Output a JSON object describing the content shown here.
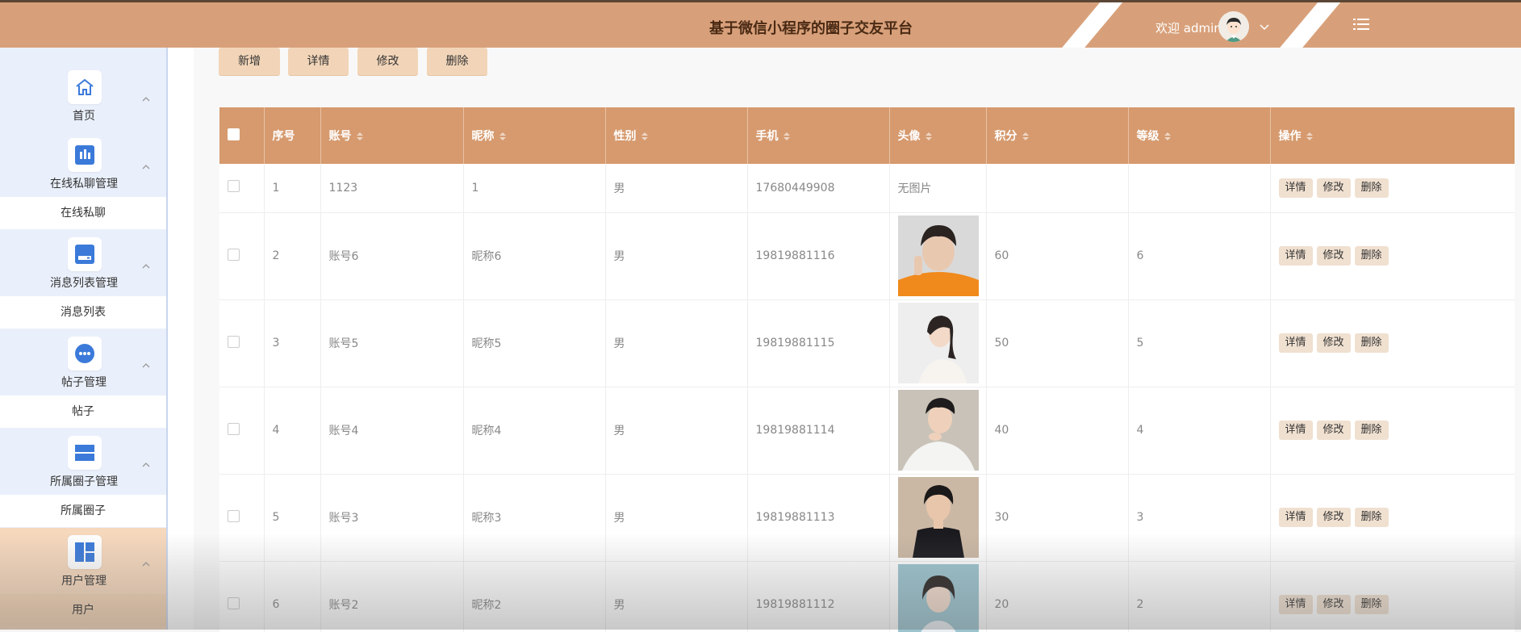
{
  "header": {
    "title": "基于微信小程序的圈子交友平台",
    "welcome": "欢迎 admin",
    "avatar_icon": "user-avatar-icon",
    "menu_icon": "menu-icon"
  },
  "sidebar": {
    "groups": [
      {
        "label": "首页",
        "icon": "home-icon"
      },
      {
        "label": "在线私聊管理",
        "icon": "chart-bars-icon",
        "sub": "在线私聊"
      },
      {
        "label": "消息列表管理",
        "icon": "drive-icon",
        "sub": "消息列表"
      },
      {
        "label": "帖子管理",
        "icon": "dots-circle-icon",
        "sub": "帖子"
      },
      {
        "label": "所属圈子管理",
        "icon": "panels-icon",
        "sub": "所属圈子"
      },
      {
        "label": "用户管理",
        "icon": "dashboard-icon",
        "sub": "用户"
      }
    ]
  },
  "toolbar": {
    "add": "新增",
    "detail": "详情",
    "edit": "修改",
    "delete": "删除"
  },
  "table": {
    "headers": [
      "序号",
      "账号",
      "昵称",
      "性别",
      "手机",
      "头像",
      "积分",
      "等级",
      "操作"
    ],
    "no_image": "无图片",
    "ops": [
      "详情",
      "修改",
      "删除"
    ],
    "rows": [
      {
        "index": "1",
        "account": "1123",
        "nickname": "1",
        "gender": "男",
        "phone": "17680449908",
        "points": "",
        "level": ""
      },
      {
        "index": "2",
        "account": "账号6",
        "nickname": "昵称6",
        "gender": "男",
        "phone": "19819881116",
        "points": "60",
        "level": "6"
      },
      {
        "index": "3",
        "account": "账号5",
        "nickname": "昵称5",
        "gender": "男",
        "phone": "19819881115",
        "points": "50",
        "level": "5"
      },
      {
        "index": "4",
        "account": "账号4",
        "nickname": "昵称4",
        "gender": "男",
        "phone": "19819881114",
        "points": "40",
        "level": "4"
      },
      {
        "index": "5",
        "account": "账号3",
        "nickname": "昵称3",
        "gender": "男",
        "phone": "19819881113",
        "points": "30",
        "level": "3"
      },
      {
        "index": "6",
        "account": "账号2",
        "nickname": "昵称2",
        "gender": "男",
        "phone": "19819881112",
        "points": "20",
        "level": "2"
      }
    ]
  },
  "colors": {
    "header_bg": "#d8a07a",
    "table_header_bg": "#d69a6e",
    "button_bg": "#f2d5b8",
    "sidebar_bg": "#eaf0fb",
    "icon_blue": "#3b7ad9"
  }
}
